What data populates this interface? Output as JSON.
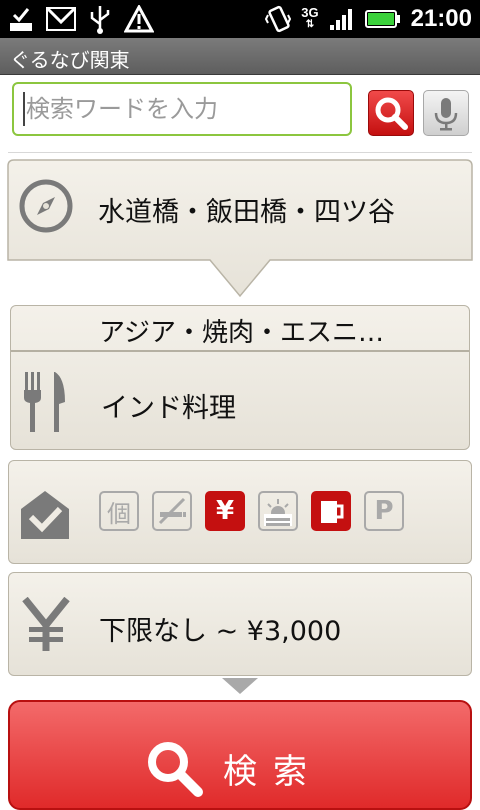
{
  "status_bar": {
    "time": "21:00",
    "network": "3G",
    "icons": [
      "download-done-icon",
      "gmail-icon",
      "usb-icon",
      "warning-icon",
      "vibrate-icon",
      "signal-icon",
      "battery-icon"
    ]
  },
  "app_title": "ぐるなび関東",
  "search": {
    "placeholder": "検索ワードを入力",
    "value": ""
  },
  "area": {
    "label": "水道橋・飯田橋・四ツ谷",
    "icon": "compass-icon"
  },
  "genre": {
    "top_label": "アジア・焼肉・エスニ…",
    "label": "インド料理",
    "icon": "fork-knife-icon"
  },
  "filters": {
    "icon": "checkbox-house-icon",
    "items": [
      {
        "name": "private-room",
        "glyph": "個",
        "active": false
      },
      {
        "name": "no-smoking",
        "glyph": "",
        "active": false
      },
      {
        "name": "coupon",
        "glyph": "¥",
        "active": true
      },
      {
        "name": "night-view",
        "glyph": "",
        "active": false
      },
      {
        "name": "drink",
        "glyph": "",
        "active": true
      },
      {
        "name": "parking",
        "glyph": "P",
        "active": false
      }
    ]
  },
  "budget": {
    "label": "下限なし ~ ¥3,000",
    "icon": "yen-icon"
  },
  "search_button": {
    "label": "検索"
  },
  "colors": {
    "accent_red": "#e02a2a",
    "input_border_green": "#8cc63f",
    "card_bg": "#efebe3"
  }
}
